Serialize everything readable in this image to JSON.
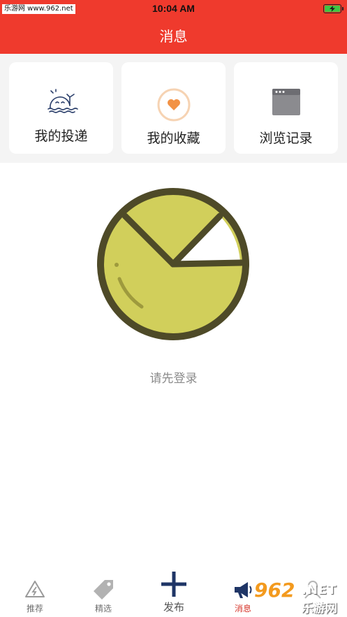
{
  "status_bar": {
    "carrier": "乐游网 www.962.net",
    "time": "10:04 AM"
  },
  "header": {
    "title": "消息"
  },
  "shortcuts": [
    {
      "label": "我的投递",
      "icon": "whale-icon"
    },
    {
      "label": "我的收藏",
      "icon": "heart-icon"
    },
    {
      "label": "浏览记录",
      "icon": "browser-window-icon"
    }
  ],
  "empty_state": {
    "message": "请先登录",
    "icon": "pie-illustration-icon"
  },
  "tabbar": {
    "tabs": [
      {
        "label": "推荐",
        "icon": "recommend-icon",
        "active": false
      },
      {
        "label": "精选",
        "icon": "tag-icon",
        "active": false
      },
      {
        "label": "发布",
        "icon": "plus-icon",
        "active": false
      },
      {
        "label": "消息",
        "icon": "megaphone-icon",
        "active": true
      },
      {
        "label": "",
        "icon": "profile-icon",
        "active": false
      }
    ]
  },
  "watermark": {
    "number": "962",
    "suffix": ".NET",
    "site": "乐游网"
  },
  "colors": {
    "header": "#ef3a2d",
    "active_tab": "#d6352a",
    "illustration_fill": "#d1cf5b",
    "illustration_outline": "#4e4a28"
  }
}
